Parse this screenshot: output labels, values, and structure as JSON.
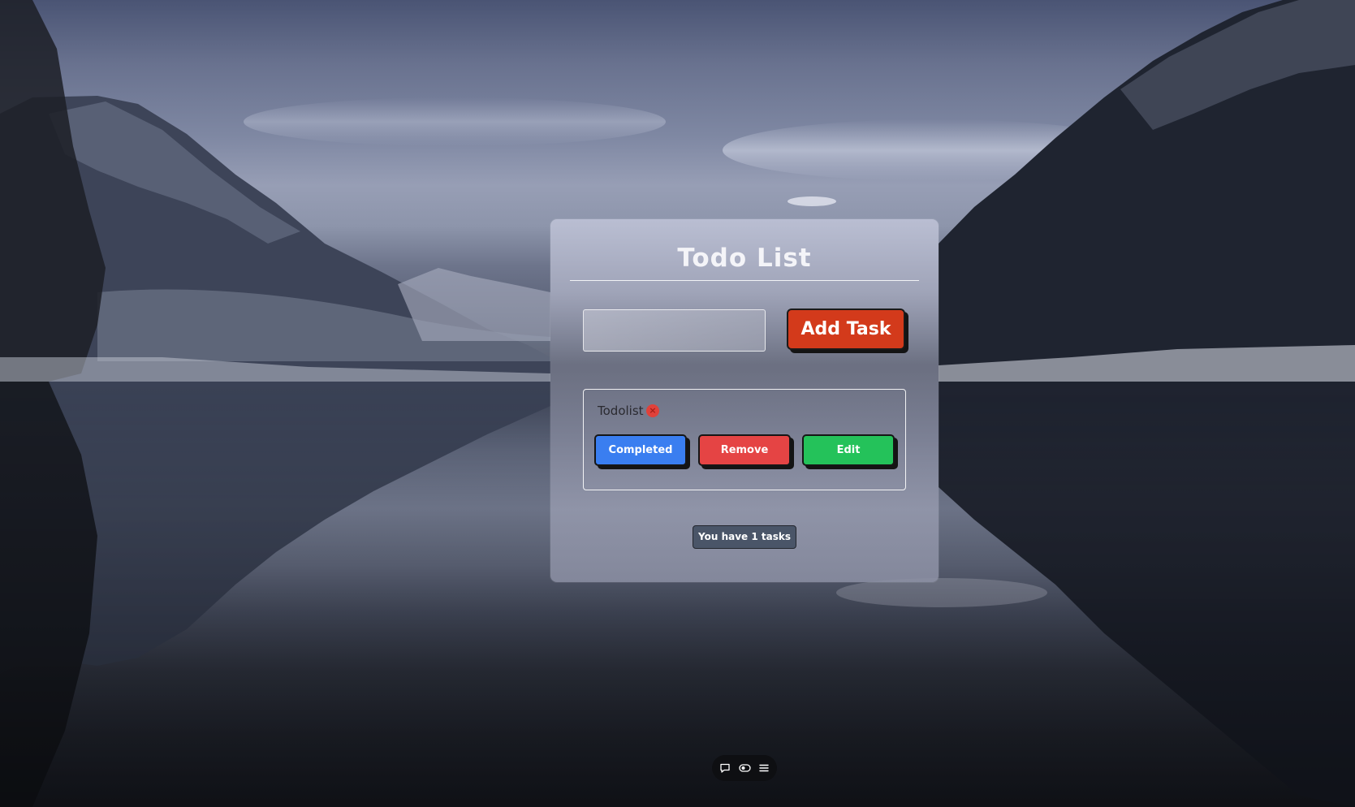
{
  "app": {
    "title": "Todo List",
    "input": {
      "value": "",
      "placeholder": ""
    },
    "add_button_label": "Add Task",
    "tasks": [
      {
        "text": "Todolist",
        "delete_icon": "close-circle-icon",
        "actions": {
          "completed": "Completed",
          "remove": "Remove",
          "edit": "Edit"
        }
      }
    ],
    "task_count_text": "You have 1 tasks"
  },
  "toolbar": {
    "icons": [
      "chat-bubble-icon",
      "eye-toggle-icon",
      "menu-icon"
    ]
  },
  "colors": {
    "add_button": "#d33a1b",
    "completed_button": "#3a7ef0",
    "remove_button": "#e54444",
    "edit_button": "#24c25a",
    "badge_bg": "#4a5568",
    "delete_dot": "#e0413a"
  }
}
